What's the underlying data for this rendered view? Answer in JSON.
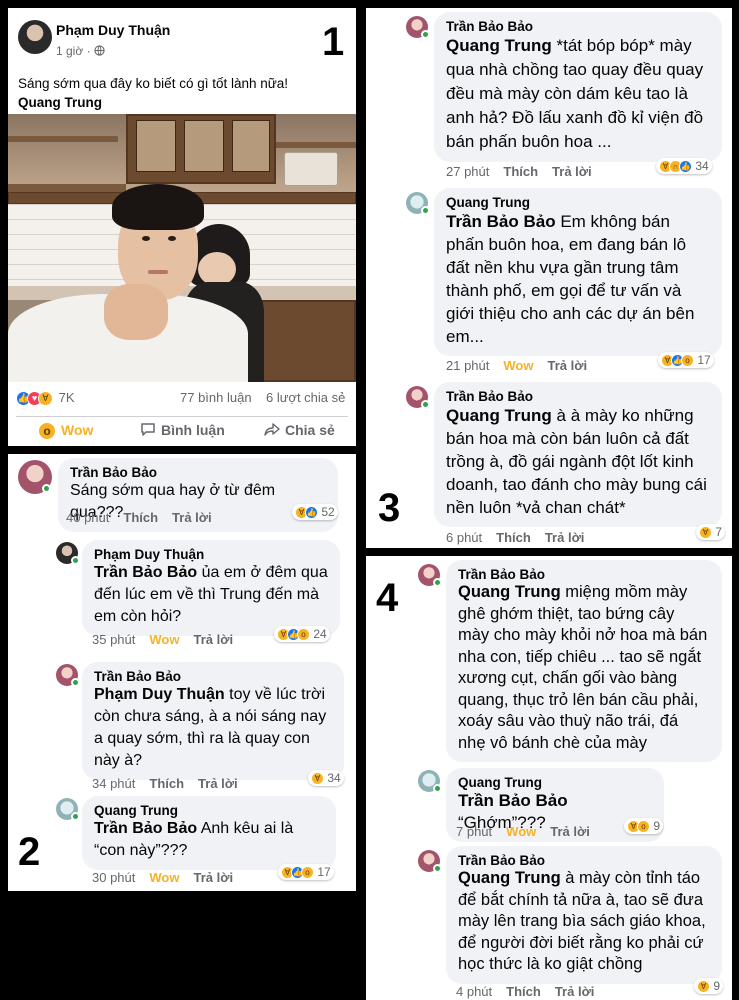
{
  "colors": {
    "like": "#1877f2",
    "love": "#f33e58",
    "wow": "#f7b125",
    "meta_gray": "#65676b",
    "bubble_bg": "#f0f2f5"
  },
  "panel_numbers": [
    "1",
    "2",
    "3",
    "4"
  ],
  "post": {
    "author": "Phạm Duy Thuận",
    "time": "1 giờ",
    "audience_icon": "globe-icon",
    "text": "Sáng sớm qua đây ko biết có gì tốt lành nữa!",
    "tag": "Quang Trung",
    "reaction_count": "7K",
    "reaction_icons": [
      "like-icon",
      "love-icon",
      "haha-icon"
    ],
    "comments_count": "77 bình luận",
    "shares_count": "6 lượt chia sẻ",
    "actions": {
      "wow": "Wow",
      "comment": "Bình luận",
      "share": "Chia sẻ"
    }
  },
  "labels": {
    "like": "Thích",
    "reply": "Trả lời",
    "wow": "Wow"
  },
  "panel2": [
    {
      "author": "Trần Bảo Bảo",
      "mention": "",
      "text": "Sáng sớm qua hay ở từ đêm qua???",
      "time": "40 phút",
      "reaction": "Thích",
      "count": "52",
      "icons": [
        "haha-icon",
        "like-icon"
      ]
    },
    {
      "author": "Phạm Duy Thuận",
      "mention": "Trần Bảo Bảo",
      "text": "ủa em ở đêm qua đến lúc em về thì Trung đến mà em còn hỏi?",
      "time": "35 phút",
      "reaction": "Wow",
      "count": "24",
      "icons": [
        "haha-icon",
        "like-icon",
        "wow-icon"
      ]
    },
    {
      "author": "Trần Bảo Bảo",
      "mention": "Phạm Duy Thuận",
      "text": "toy về lúc trời còn chưa sáng, à a nói sáng nay a quay sớm, thì ra là quay con này à?",
      "time": "34 phút",
      "reaction": "Thích",
      "count": "34",
      "icons": [
        "haha-icon"
      ]
    },
    {
      "author": "Quang Trung",
      "mention": "Trần Bảo Bảo",
      "text": "Anh kêu ai là “con này”???",
      "time": "30 phút",
      "reaction": "Wow",
      "count": "17",
      "icons": [
        "haha-icon",
        "like-icon",
        "wow-icon"
      ]
    }
  ],
  "panel3": [
    {
      "author": "Trần Bảo Bảo",
      "mention": "Quang Trung",
      "text": "*tát bóp bóp* mày qua nhà chồng tao quay đều quay đều mà mày còn dám kêu tao là anh hả? Đồ lấu xanh đồ kỉ viện đồ bán phấn buôn hoa ...",
      "time": "27 phút",
      "reaction": "Thích",
      "count": "34",
      "icons": [
        "haha-icon",
        "sad-icon",
        "like-icon"
      ]
    },
    {
      "author": "Quang Trung",
      "mention": "Trần Bảo Bảo",
      "text": "Em không bán phấn buôn hoa, em đang bán lô đất nền khu vựa gần trung tâm thành phố, em gọi để tư vấn và giới thiệu cho anh các dự án bên em...",
      "time": "21 phút",
      "reaction": "Wow",
      "count": "17",
      "icons": [
        "haha-icon",
        "like-icon",
        "wow-icon"
      ]
    },
    {
      "author": "Trần Bảo Bảo",
      "mention": "Quang Trung",
      "text": "à à mày ko những bán hoa mà còn bán luôn cả đất trồng à, đồ gái ngành đột lốt kinh doanh, tao đánh cho mày bung cái nền luôn *vả chan chát*",
      "time": "6 phút",
      "reaction": "Thích",
      "count": "7",
      "icons": [
        "haha-icon"
      ]
    }
  ],
  "panel4": [
    {
      "author": "Trần Bảo Bảo",
      "mention": "Quang Trung",
      "text": "miệng mồm mày ghê ghớm thiệt, tao bứng cây mày cho mày khỏi nở hoa mà bán nha con, tiếp chiêu ... tao sẽ ngắt xương cụt, chấn gối vào bàng quang, thục trỏ lên bán cầu phải, xoáy sâu vào thuỳ não trái, đá nhẹ vô bánh chè của mày",
      "time": "",
      "reaction": "",
      "count": "",
      "icons": []
    },
    {
      "author": "Quang Trung",
      "mention": "Trần Bảo Bảo",
      "text": "“Ghớm”???",
      "time": "7 phút",
      "reaction": "Wow",
      "count": "9",
      "icons": [
        "haha-icon",
        "wow-icon"
      ]
    },
    {
      "author": "Trần Bảo Bảo",
      "mention": "Quang Trung",
      "text": "à mày còn tỉnh táo để bắt chính tả nữa à, tao sẽ đưa mày lên trang bìa sách giáo khoa, để người đời biết rằng ko phải cứ học thức là ko giật chồng",
      "time": "4 phút",
      "reaction": "Thích",
      "count": "9",
      "icons": [
        "haha-icon"
      ]
    }
  ]
}
